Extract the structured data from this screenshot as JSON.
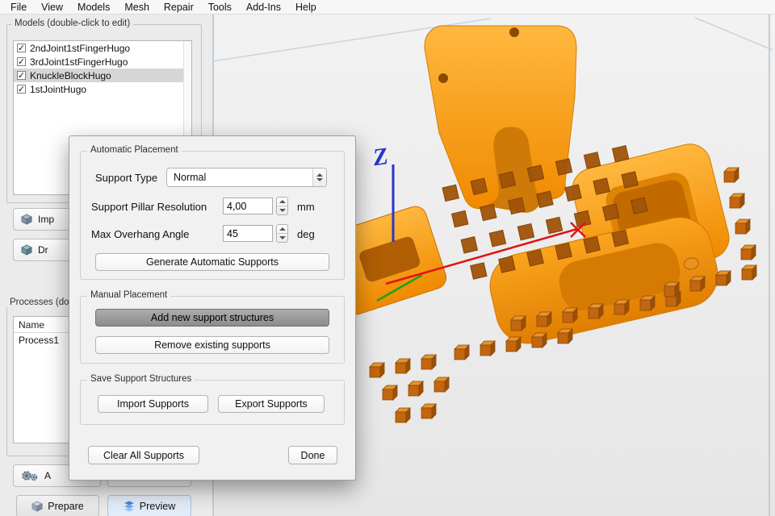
{
  "menu": {
    "items": [
      "File",
      "View",
      "Models",
      "Mesh",
      "Repair",
      "Tools",
      "Add-Ins",
      "Help"
    ]
  },
  "glyphs": {
    "check": "✓"
  },
  "left_panel": {
    "models_group": {
      "title": "Models (double-click to edit)",
      "items": [
        {
          "label": "2ndJoint1stFingerHugo",
          "checked": true
        },
        {
          "label": "3rdJoint1stFingerHugo",
          "checked": true
        },
        {
          "label": "KnuckleBlockHugo",
          "checked": true
        },
        {
          "label": "1stJointHugo",
          "checked": true
        }
      ]
    },
    "import_button_label": "Imp",
    "drop_button_label": "Dr",
    "processes_group": {
      "title": "Processes (do",
      "table_header": "Name",
      "rows": [
        "Process1"
      ]
    },
    "action_button_left_label": "A",
    "tabs": {
      "prepare": "Prepare",
      "preview": "Preview"
    }
  },
  "support_dialog": {
    "automatic": {
      "title": "Automatic Placement",
      "support_type_label": "Support Type",
      "support_type_value": "Normal",
      "resolution_label": "Support Pillar Resolution",
      "resolution_value": "4,00",
      "resolution_unit": "mm",
      "overhang_label": "Max Overhang Angle",
      "overhang_value": "45",
      "overhang_unit": "deg",
      "generate_label": "Generate Automatic Supports"
    },
    "manual": {
      "title": "Manual Placement",
      "add_label": "Add new support structures",
      "remove_label": "Remove existing supports"
    },
    "save": {
      "title": "Save Support Structures",
      "import_label": "Import Supports",
      "export_label": "Export Supports"
    },
    "clear_label": "Clear All Supports",
    "done_label": "Done"
  },
  "viewport": {
    "z_label": "Z",
    "colors": {
      "model": "#F79A1F",
      "model_dark": "#C97000",
      "support": "#B45F0B",
      "axis_x": "#E21212",
      "axis_y": "#1AA31C",
      "axis_z": "#2A35C8",
      "bounds": "#BFCDD9"
    }
  }
}
